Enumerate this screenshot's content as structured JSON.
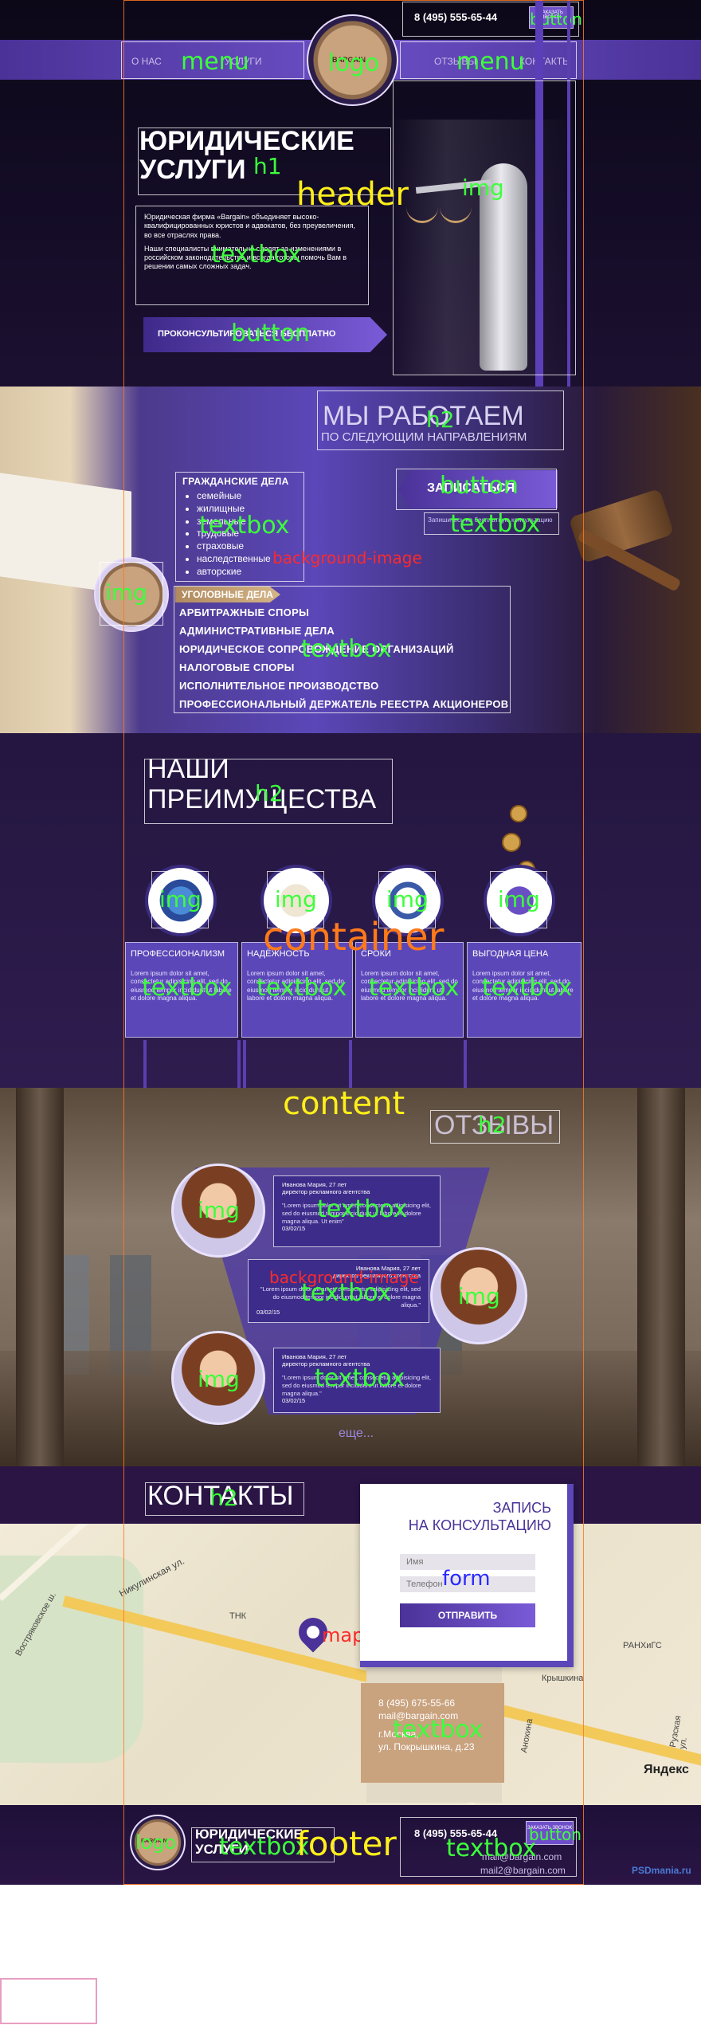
{
  "header": {
    "phone": "8 (495) 555-65-44",
    "callback_button": "ЗАКАЗАТЬ ЗВОНОК",
    "nav_left": [
      "О НАС",
      "УСЛУГИ"
    ],
    "nav_right": [
      "ОТЗЫВЫ",
      "КОНТАКТЫ"
    ],
    "logo_text": "BARGAIN",
    "title_line1": "ЮРИДИЧЕСКИЕ",
    "title_line2": "УСЛУГИ",
    "intro_p1": "Юридическая фирма «Bargain» объединяет высоко-квалифицированных юристов и адвокатов, без преувеличения, во все отраслях права.",
    "intro_p2": "Наши специалисты внимательно следят за изменениями в российском законодательстве и всегда готовы помочь Вам в решении самых сложных задач.",
    "cta_button": "ПРОКОНСУЛЬТИРОВАТЬСЯ БЕСПЛАТНО"
  },
  "services": {
    "title": "МЫ РАБОТАЕМ",
    "subtitle": "ПО СЛЕДУЮЩИМ НАПРАВЛЕНИЯМ",
    "signup_button": "ЗАПИСАТЬСЯ",
    "signup_note": "Запишитесь на бесплатную консультацию",
    "civil_heading": "ГРАЖДАНСКИЕ ДЕЛА",
    "civil_items": [
      "семейные",
      "жилищные",
      "земельные",
      "трудовые",
      "страховые",
      "наследственные",
      "авторские"
    ],
    "other_items": [
      "УГОЛОВНЫЕ ДЕЛА",
      "АРБИТРАЖНЫЕ СПОРЫ",
      "АДМИНИСТРАТИВНЫЕ ДЕЛА",
      "ЮРИДИЧЕСКОЕ СОПРОВОЖДЕНИЕ ОРГАНИЗАЦИЙ",
      "НАЛОГОВЫЕ СПОРЫ",
      "ИСПОЛНИТЕЛЬНОЕ ПРОИЗВОДСТВО",
      "ПРОФЕССИОНАЛЬНЫЙ ДЕРЖАТЕЛЬ РЕЕСТРА АКЦИОНЕРОВ"
    ]
  },
  "advantages": {
    "title_line1": "НАШИ",
    "title_line2": "ПРЕИМУЩЕСТВА",
    "cards": [
      {
        "title": "ПРОФЕССИОНАЛИЗМ",
        "body": "Lorem ipsum dolor sit amet, consectetur adipisicing elit, sed do eiusmod tempor incididunt ut labore et dolore magna aliqua."
      },
      {
        "title": "НАДЁЖНОСТЬ",
        "body": "Lorem ipsum dolor sit amet, consectetur adipisicing elit, sed do eiusmod tempor incididunt ut labore et dolore magna aliqua."
      },
      {
        "title": "СРОКИ",
        "body": "Lorem ipsum dolor sit amet, consectetur adipisicing elit, sed do eiusmod tempor incididunt ut labore et dolore magna aliqua."
      },
      {
        "title": "ВЫГОДНАЯ ЦЕНА",
        "body": "Lorem ipsum dolor sit amet, consectetur adipisicing elit, sed do eiusmod tempor incididunt ut labore et dolore magna aliqua."
      }
    ]
  },
  "reviews": {
    "title": "ОТЗЫВЫ",
    "items": [
      {
        "name": "Иванова Мария, 27 лет",
        "role": "директор рекламного агентства",
        "text": "\"Lorem ipsum dolor sit amet, consectetur adipisicing elit, sed do eiusmod tempor incididunt ut labore et dolore magna aliqua. Ut enim\"",
        "date": "03/02/15"
      },
      {
        "name": "Иванова Мария, 27 лет",
        "role": "директор рекламного агентства",
        "text": "\"Lorem ipsum dolor sit amet, consectetur adipisicing elit, sed do eiusmod tempor incididunt ut labore et dolore magna aliqua.\"",
        "date": "03/02/15"
      },
      {
        "name": "Иванова Мария, 27 лет",
        "role": "директор рекламного агентства",
        "text": "\"Lorem ipsum dolor sit amet, consectetur adipisicing elit, sed do eiusmod tempor incididunt ut labore et dolore magna aliqua.\"",
        "date": "03/02/15"
      }
    ],
    "more_link": "еще..."
  },
  "contacts": {
    "title": "КОНТАКТЫ",
    "form_title_line1": "ЗАПИСЬ",
    "form_title_line2": "НА КОНСУЛЬТАЦИЮ",
    "name_placeholder": "Имя",
    "phone_placeholder": "Телефон",
    "submit_button": "ОТПРАВИТЬ",
    "map_labels": [
      "Никулинская ул.",
      "Востряковское ш.",
      "ТНК",
      "РАНХиГС",
      "Крышкина",
      "Анохина",
      "Рузская ул.",
      "Яндекс"
    ],
    "info_phone": "8 (495) 675-55-66",
    "info_email": "mail@bargain.com",
    "info_city": "г.Москва,",
    "info_street": "ул. Покрышкина, д.23"
  },
  "footer": {
    "logo_text": "BARGAIN",
    "title_line1": "ЮРИДИЧЕСКИЕ",
    "title_line2": "УСЛУГИ",
    "phone": "8 (495) 555-65-44",
    "callback_button": "ЗАКАЗАТЬ ЗВОНОК",
    "email1": "mail@bargain.com",
    "email2": "mail2@bargain.com",
    "watermark": "PSDmania.ru"
  },
  "annotations": {
    "button": "button",
    "menu": "menu",
    "logo": "logo",
    "h1": "h1",
    "header": "header",
    "img": "img",
    "textbox": "textbox",
    "h2": "h2",
    "background_image": "background-image",
    "container": "container",
    "content": "content",
    "form": "form",
    "maps": "maps",
    "footer": "footer"
  },
  "colors": {
    "dark_purple": "#2a1545",
    "accent_purple": "#6a4fc4",
    "annotation_green": "#3cff3c",
    "annotation_yellow": "#ffef1a",
    "annotation_orange": "#ff7a1a",
    "annotation_red": "#ff2a2a",
    "annotation_blue": "#2a2aff"
  }
}
